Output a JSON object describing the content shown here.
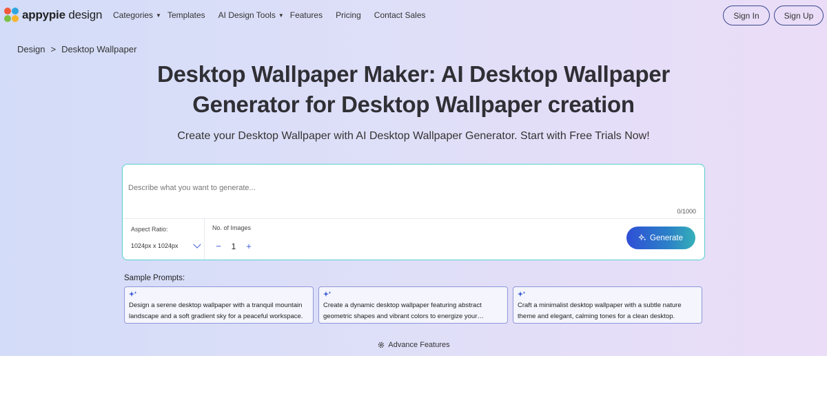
{
  "nav": {
    "logo_bold": "appypie",
    "logo_light": " design",
    "links": [
      {
        "label": "Categories",
        "dropdown": true
      },
      {
        "label": "Templates",
        "dropdown": false
      },
      {
        "label": "AI Design Tools",
        "dropdown": true
      },
      {
        "label": "Features",
        "dropdown": false
      },
      {
        "label": "Pricing",
        "dropdown": false
      },
      {
        "label": "Contact Sales",
        "dropdown": false
      }
    ],
    "sign_in": "Sign In",
    "sign_up": "Sign Up"
  },
  "breadcrumb": {
    "root": "Design",
    "separator": ">",
    "current": "Desktop Wallpaper"
  },
  "hero": {
    "title_line1": "Desktop Wallpaper Maker: AI Desktop Wallpaper",
    "title_line2": "Generator for Desktop Wallpaper creation",
    "subtitle": "Create your Desktop Wallpaper with AI Desktop Wallpaper Generator. Start with Free Trials Now!"
  },
  "prompt": {
    "placeholder": "Describe what you want to generate...",
    "value": "",
    "counter": "0/1000",
    "aspect_label": "Aspect Ratio:",
    "aspect_value": "1024px x 1024px",
    "num_label": "No. of Images",
    "num_value": "1",
    "minus": "−",
    "plus": "+",
    "generate_label": "Generate"
  },
  "samples": {
    "label": "Sample Prompts:",
    "items": [
      "Design a serene desktop wallpaper with a tranquil mountain landscape and a soft gradient sky for a peaceful workspace.",
      "Create a dynamic desktop wallpaper featuring abstract geometric shapes and vibrant colors to energize your workspace.",
      "Craft a minimalist desktop wallpaper with a subtle nature theme and elegant, calming tones for a clean desktop."
    ]
  },
  "advance_features": "Advance Features",
  "colors": {
    "accent": "#3b5bd6",
    "box_border": "#55d0cf"
  },
  "icons": {
    "sparkle": "sparkle-icon",
    "gear": "gear-icon",
    "chevron": "chevron-down-icon"
  }
}
